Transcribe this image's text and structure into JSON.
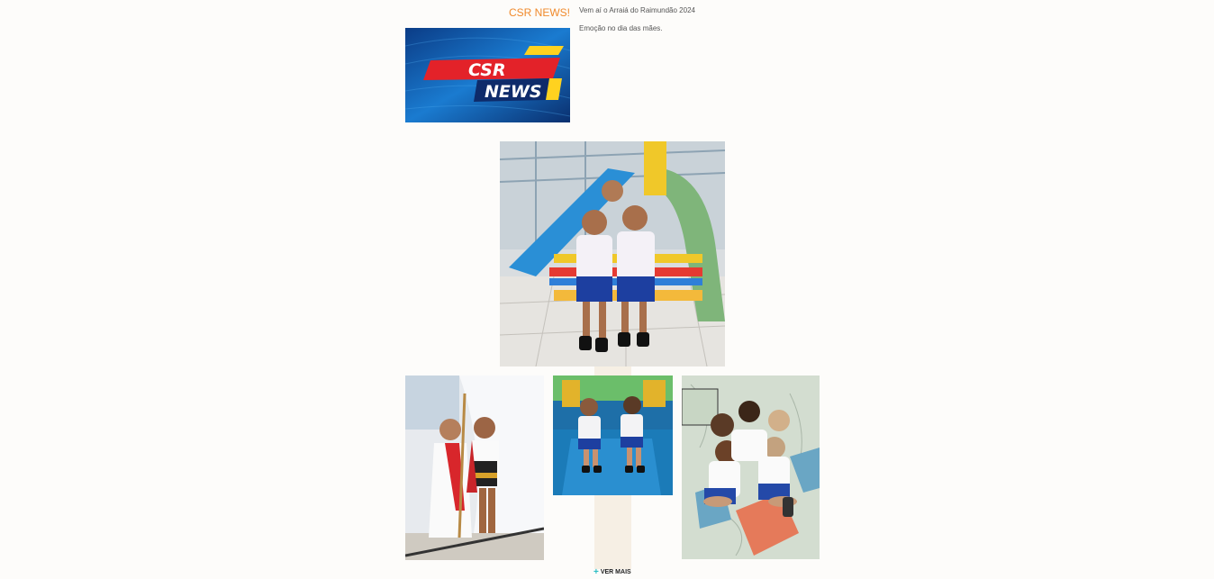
{
  "news": {
    "title": "CSR NEWS!",
    "logo_text_top": "CSR",
    "logo_text_bottom": "NEWS",
    "items": [
      "Vem aí o Arraiá do Raimundão 2024",
      "Emoção no dia das mães."
    ]
  },
  "gallery": {
    "photos": [
      {
        "subject": "two boys on a bench by slides"
      },
      {
        "subject": "two children in costumes"
      },
      {
        "subject": "two girls on a slide"
      },
      {
        "subject": "group of girls hugging on a hopscotch mat"
      }
    ],
    "more_label": "VER MAIS"
  },
  "colors": {
    "title_orange": "#f08a2c",
    "accent_teal": "#2bbdc4",
    "background": "#fdfcfa"
  }
}
